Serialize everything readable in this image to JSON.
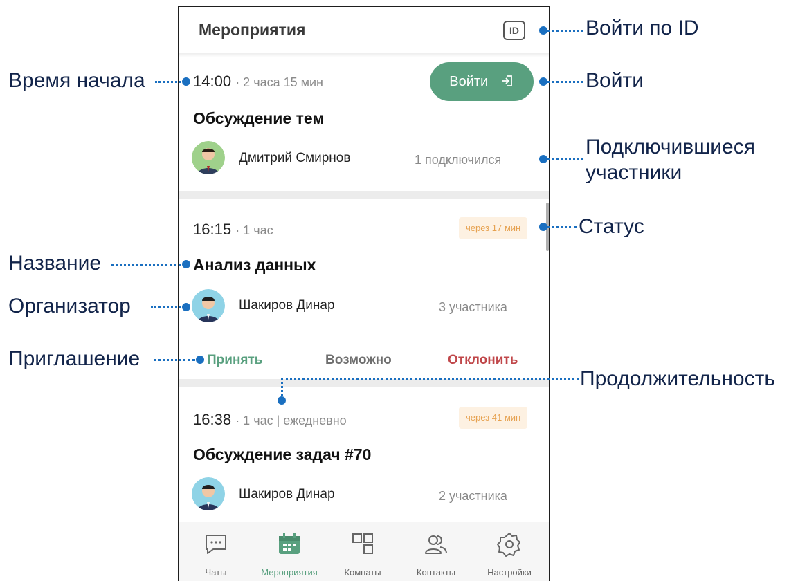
{
  "header": {
    "title": "Мероприятия",
    "id_label": "ID"
  },
  "events": [
    {
      "time": "14:00",
      "meta": "· 2 часа 15 мин",
      "title": "Обсуждение тем",
      "organizer": "Дмитрий Смирнов",
      "count": "1 подключился",
      "enter_label": "Войти"
    },
    {
      "time": "16:15",
      "meta": "· 1 час",
      "status": "через 17 мин",
      "title": "Анализ данных",
      "organizer": "Шакиров Динар",
      "count": "3 участника",
      "actions": {
        "accept": "Принять",
        "maybe": "Возможно",
        "decline": "Отклонить"
      }
    },
    {
      "time": "16:38",
      "meta": "· 1 час | ежедневно",
      "status": "через 41 мин",
      "title": "Обсуждение задач #70",
      "organizer": "Шакиров Динар",
      "count": "2 участника"
    }
  ],
  "nav": [
    {
      "label": "Чаты",
      "icon": "chat-icon",
      "active": false
    },
    {
      "label": "Мероприятия",
      "icon": "calendar-icon",
      "active": true
    },
    {
      "label": "Комнаты",
      "icon": "rooms-icon",
      "active": false
    },
    {
      "label": "Контакты",
      "icon": "contacts-icon",
      "active": false
    },
    {
      "label": "Настройки",
      "icon": "settings-icon",
      "active": false
    }
  ],
  "annotations": {
    "login_by_id": "Войти по ID",
    "start_time": "Время начала",
    "enter": "Войти",
    "connected": "Подключившиеся участники",
    "connected_line1": "Подключившиеся",
    "connected_line2": "участники",
    "status": "Статус",
    "name": "Название",
    "organizer": "Организатор",
    "invitation": "Приглашение",
    "duration": "Продолжительность"
  },
  "colors": {
    "accent": "#59a07f",
    "decline": "#c0474a",
    "status_bg": "#fdf1e2",
    "status_text": "#e6a14f",
    "annotation_line": "#1a6fc0"
  }
}
